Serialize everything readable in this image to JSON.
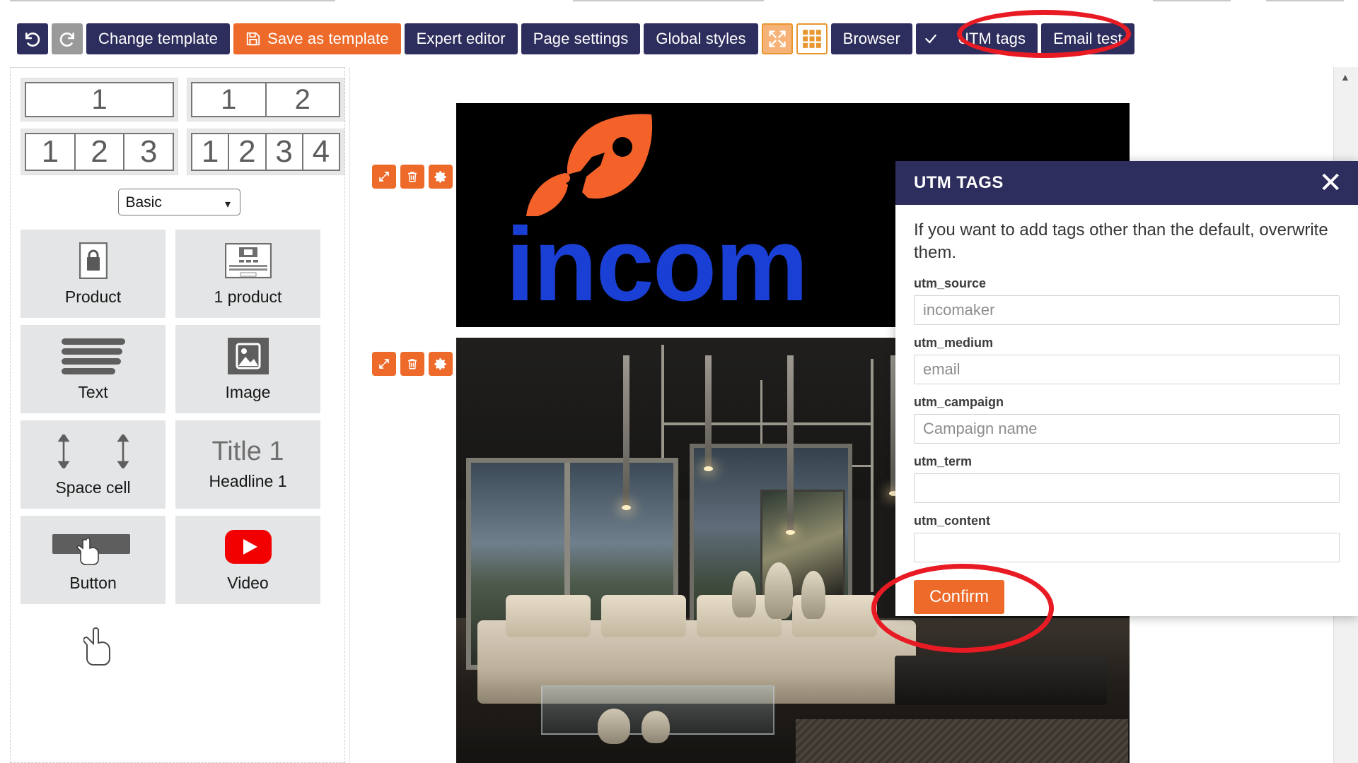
{
  "toolbar": {
    "undo_icon": "undo-icon",
    "redo_icon": "redo-icon",
    "change_template": "Change template",
    "save_as_template": "Save as template",
    "save_icon": "floppy-disk-icon",
    "expert_editor": "Expert editor",
    "page_settings": "Page settings",
    "global_styles": "Global styles",
    "expand_icon": "expand-arrows-icon",
    "grid_icon": "grid-icon",
    "browser": "Browser",
    "check_icon": "check-icon",
    "utm_tags": "UTM tags",
    "email_test": "Email test"
  },
  "sidebar": {
    "layouts": [
      {
        "name": "one-column",
        "cells": [
          "1"
        ]
      },
      {
        "name": "two-column",
        "cells": [
          "1",
          "2"
        ]
      },
      {
        "name": "three-column",
        "cells": [
          "1",
          "2",
          "3"
        ]
      },
      {
        "name": "four-column",
        "cells": [
          "1",
          "2",
          "3",
          "4"
        ]
      }
    ],
    "category_selected": "Basic",
    "category_options": [
      "Basic"
    ],
    "tiles": [
      {
        "label": "Product",
        "icon": "product-bag-icon"
      },
      {
        "label": "1 product",
        "icon": "one-product-card-icon"
      },
      {
        "label": "Text",
        "icon": "text-lines-icon"
      },
      {
        "label": "Image",
        "icon": "image-picture-icon"
      },
      {
        "label": "Space cell",
        "icon": "vertical-arrows-icon"
      },
      {
        "label": "Headline 1",
        "icon": "title-text-icon",
        "preview": "Title 1"
      },
      {
        "label": "Button",
        "icon": "button-click-icon"
      },
      {
        "label": "Video",
        "icon": "youtube-play-icon"
      }
    ]
  },
  "canvas": {
    "block_toolbar_icons": [
      "move-resize-icon",
      "trash-icon",
      "gear-icon"
    ],
    "hero_text": "incom",
    "hero_icon": "rocket-icon",
    "blocks": [
      "hero-logo-block",
      "interior-photo-block"
    ]
  },
  "modal": {
    "title": "UTM TAGS",
    "close_icon": "close-icon",
    "intro": "If you want to add tags other than the default, overwrite them.",
    "fields": [
      {
        "label": "utm_source",
        "value": "",
        "placeholder": "incomaker"
      },
      {
        "label": "utm_medium",
        "value": "",
        "placeholder": "email"
      },
      {
        "label": "utm_campaign",
        "value": "",
        "placeholder": "Campaign name"
      },
      {
        "label": "utm_term",
        "value": "",
        "placeholder": ""
      },
      {
        "label": "utm_content",
        "value": "",
        "placeholder": ""
      }
    ],
    "confirm_label": "Confirm"
  },
  "annotations": [
    {
      "name": "highlight-utm-tags-button",
      "shape": "ellipse",
      "color": "#e81b24"
    },
    {
      "name": "highlight-confirm-button",
      "shape": "ellipse",
      "color": "#e81b24"
    }
  ],
  "colors": {
    "toolbar_dark": "#2e2e5e",
    "accent_orange": "#ee6a2a",
    "annotation_red": "#e81b24",
    "tile_bg": "#e4e5e6"
  }
}
